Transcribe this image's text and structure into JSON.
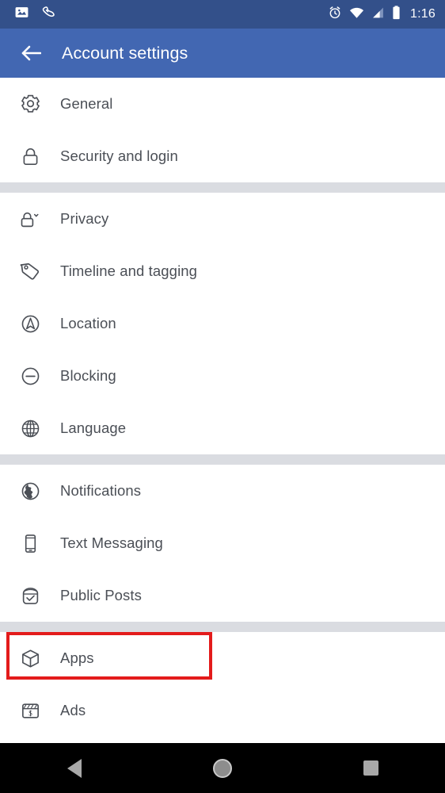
{
  "status_bar": {
    "background_color": "#33508a",
    "left_icons": [
      {
        "name": "image-icon",
        "label": "Screenshot"
      },
      {
        "name": "shoe-icon",
        "label": "Fitness"
      }
    ],
    "right_icons": [
      {
        "name": "alarm-clock-icon",
        "label": "Alarm set"
      },
      {
        "name": "wifi-icon",
        "label": "Wi-Fi full"
      },
      {
        "name": "cellular-signal-icon",
        "label": "Cellular partial"
      },
      {
        "name": "battery-icon",
        "label": "Battery full"
      }
    ],
    "time": "1:16"
  },
  "app_bar": {
    "background_color": "#4267b2",
    "back_label": "Back",
    "title": "Account settings"
  },
  "settings": {
    "text_color": "#4b4f56",
    "divider_color": "#dadce1",
    "highlight_color": "#e31b1b",
    "groups": [
      {
        "items": [
          {
            "icon": "gear-icon",
            "label": "General",
            "highlighted": false
          },
          {
            "icon": "lock-icon",
            "label": "Security and login",
            "highlighted": false
          }
        ]
      },
      {
        "items": [
          {
            "icon": "lock-chevron-icon",
            "label": "Privacy",
            "highlighted": false
          },
          {
            "icon": "tag-icon",
            "label": "Timeline and tagging",
            "highlighted": false
          },
          {
            "icon": "location-arrow-icon",
            "label": "Location",
            "highlighted": false
          },
          {
            "icon": "minus-circle-icon",
            "label": "Blocking",
            "highlighted": false
          },
          {
            "icon": "globe-grid-icon",
            "label": "Language",
            "highlighted": false
          }
        ]
      },
      {
        "items": [
          {
            "icon": "earth-globe-icon",
            "label": "Notifications",
            "highlighted": false
          },
          {
            "icon": "phone-icon",
            "label": "Text Messaging",
            "highlighted": false
          },
          {
            "icon": "box-check-icon",
            "label": "Public Posts",
            "highlighted": false
          }
        ]
      },
      {
        "items": [
          {
            "icon": "cube-icon",
            "label": "Apps",
            "highlighted": true
          },
          {
            "icon": "billboard-dollar-icon",
            "label": "Ads",
            "highlighted": false
          }
        ]
      }
    ]
  },
  "nav_bar": {
    "background_color": "#000000",
    "buttons": [
      {
        "name": "nav-back-button",
        "label": "Back"
      },
      {
        "name": "nav-home-button",
        "label": "Home"
      },
      {
        "name": "nav-recents-button",
        "label": "Recent apps"
      }
    ]
  }
}
